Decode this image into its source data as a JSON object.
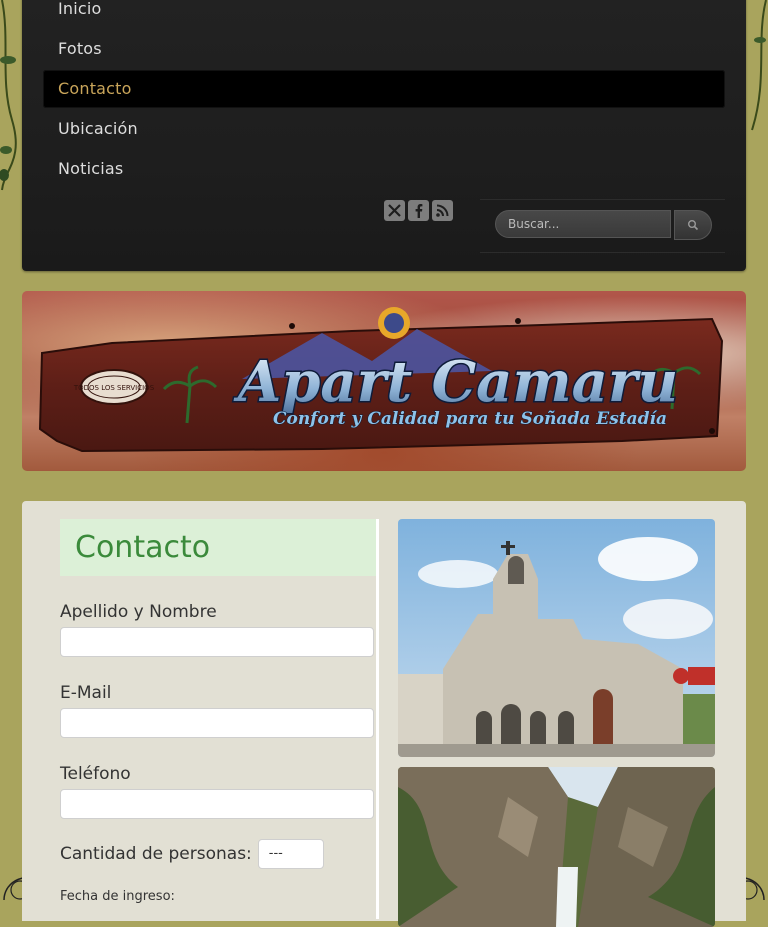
{
  "nav": {
    "items": [
      {
        "label": "Inicio",
        "active": false
      },
      {
        "label": "Fotos",
        "active": false
      },
      {
        "label": "Contacto",
        "active": true
      },
      {
        "label": "Ubicación",
        "active": false
      },
      {
        "label": "Noticias",
        "active": false
      }
    ]
  },
  "social": {
    "icons": [
      "x-icon",
      "facebook-icon",
      "rss-icon"
    ]
  },
  "search": {
    "placeholder": "Buscar..."
  },
  "banner": {
    "title": "Apart Camaru",
    "slogan": "Confort y Calidad para tu Soñada Estadía",
    "badge": "TODOS LOS SERVICIOS"
  },
  "form": {
    "title": "Contacto",
    "name_label": "Apellido y Nombre",
    "email_label": "E-Mail",
    "phone_label": "Teléfono",
    "persons_label": "Cantidad de personas:",
    "persons_value": "---",
    "checkin_label": "Fecha de ingreso:"
  },
  "colors": {
    "background": "#a9a45d",
    "nav_active_text": "#c9a55a",
    "title_green": "#3b8a3b"
  }
}
